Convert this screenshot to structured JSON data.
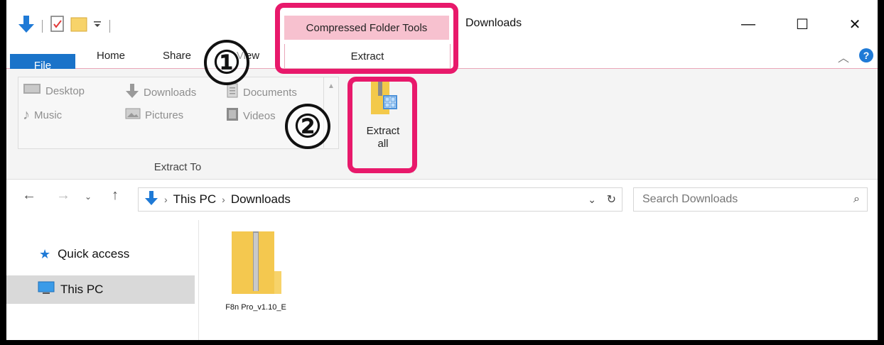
{
  "quick_access_toolbar": {
    "icons": [
      "down-arrow-icon",
      "properties-icon",
      "new-folder-icon",
      "customize-icon"
    ]
  },
  "context_tab_group": {
    "label": "Compressed Folder Tools"
  },
  "window": {
    "title": "Downloads",
    "controls": {
      "minimize": "—",
      "maximize": "☐",
      "close": "✕"
    }
  },
  "ribbon_tabs": {
    "file": "File",
    "home": "Home",
    "share": "Share",
    "view": "View",
    "extract": "Extract"
  },
  "ribbon": {
    "destinations": [
      {
        "label": "Desktop",
        "icon": "desktop-icon"
      },
      {
        "label": "Downloads",
        "icon": "downloads-icon"
      },
      {
        "label": "Documents",
        "icon": "documents-icon"
      },
      {
        "label": "Music",
        "icon": "music-icon"
      },
      {
        "label": "Pictures",
        "icon": "pictures-icon"
      },
      {
        "label": "Videos",
        "icon": "videos-icon"
      }
    ],
    "extract_to_label": "Extract To",
    "extract_all": {
      "line1": "Extract",
      "line2": "all"
    }
  },
  "annotations": {
    "step1": "①",
    "step2": "②",
    "color": "#e8196b"
  },
  "address_bar": {
    "crumbs": [
      "This PC",
      "Downloads"
    ],
    "sep": "›"
  },
  "search": {
    "placeholder": "Search Downloads"
  },
  "nav_pane": {
    "items": [
      {
        "label": "Quick access",
        "icon": "star-icon"
      },
      {
        "label": "This PC",
        "icon": "computer-icon",
        "selected": true
      }
    ]
  },
  "files": [
    {
      "name": "F8n Pro_v1.10_E",
      "icon": "zip-folder-icon"
    }
  ],
  "colors": {
    "file_tab": "#1a73c9",
    "context_tab": "#f7c1cf",
    "accent_blue": "#1f7ad6"
  }
}
